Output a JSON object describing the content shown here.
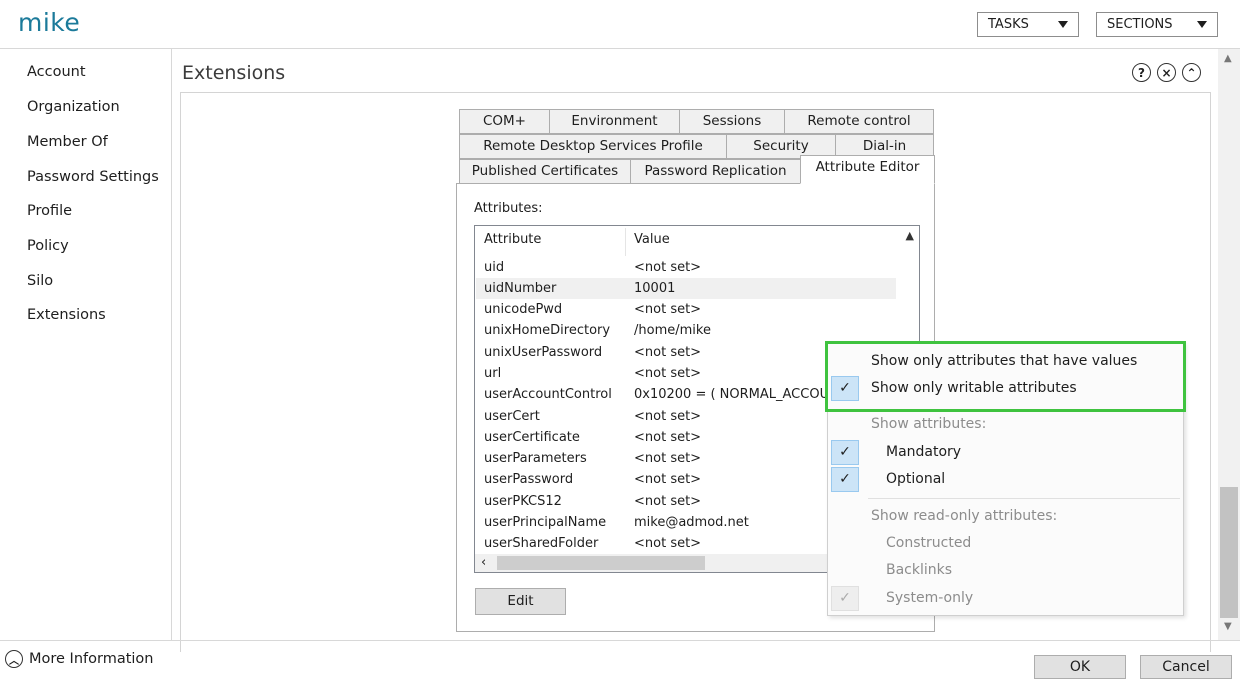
{
  "header": {
    "title": "mike",
    "tasks_label": "TASKS",
    "sections_label": "SECTIONS"
  },
  "nav": {
    "items": [
      {
        "label": "Account"
      },
      {
        "label": "Organization"
      },
      {
        "label": "Member Of"
      },
      {
        "label": "Password Settings"
      },
      {
        "label": "Profile"
      },
      {
        "label": "Policy"
      },
      {
        "label": "Silo"
      },
      {
        "label": "Extensions"
      }
    ]
  },
  "section": {
    "title": "Extensions",
    "help_icon": "?",
    "close_icon": "×",
    "collapse_icon": "⌃"
  },
  "dialog": {
    "tabs_row1": [
      {
        "label": "COM+"
      },
      {
        "label": "Environment"
      },
      {
        "label": "Sessions"
      },
      {
        "label": "Remote control"
      }
    ],
    "tabs_row2": [
      {
        "label": "Remote Desktop Services Profile"
      },
      {
        "label": "Security"
      },
      {
        "label": "Dial-in"
      }
    ],
    "tabs_row3": [
      {
        "label": "Published Certificates"
      },
      {
        "label": "Password Replication"
      },
      {
        "label": "Attribute Editor"
      }
    ],
    "attributes_label": "Attributes:",
    "columns": {
      "attribute": "Attribute",
      "value": "Value"
    },
    "rows": [
      {
        "attribute": "uid",
        "value": "<not set>"
      },
      {
        "attribute": "uidNumber",
        "value": "10001"
      },
      {
        "attribute": "unicodePwd",
        "value": "<not set>"
      },
      {
        "attribute": "unixHomeDirectory",
        "value": "/home/mike"
      },
      {
        "attribute": "unixUserPassword",
        "value": "<not set>"
      },
      {
        "attribute": "url",
        "value": "<not set>"
      },
      {
        "attribute": "userAccountControl",
        "value": "0x10200 = ( NORMAL_ACCOUNT"
      },
      {
        "attribute": "userCert",
        "value": "<not set>"
      },
      {
        "attribute": "userCertificate",
        "value": "<not set>"
      },
      {
        "attribute": "userParameters",
        "value": "<not set>"
      },
      {
        "attribute": "userPassword",
        "value": "<not set>"
      },
      {
        "attribute": "userPKCS12",
        "value": "<not set>"
      },
      {
        "attribute": "userPrincipalName",
        "value": "mike@admod.net"
      },
      {
        "attribute": "userSharedFolder",
        "value": "<not set>"
      }
    ],
    "selected_row": "uidNumber",
    "edit_label": "Edit"
  },
  "menu": {
    "items": [
      {
        "label": "Show only attributes that have values",
        "checked": false
      },
      {
        "label": "Show only writable attributes",
        "checked": true
      }
    ],
    "show_attributes_header": "Show attributes:",
    "show_attributes": [
      {
        "label": "Mandatory",
        "checked": true
      },
      {
        "label": "Optional",
        "checked": true
      }
    ],
    "readonly_header": "Show read-only attributes:",
    "readonly": [
      {
        "label": "Constructed",
        "checked": false
      },
      {
        "label": "Backlinks",
        "checked": false
      },
      {
        "label": "System-only",
        "checked": true
      }
    ],
    "check_glyph": "✓",
    "highlight_color": "#3fc33f"
  },
  "footer": {
    "more_info_label": "More Information",
    "ok_label": "OK",
    "cancel_label": "Cancel"
  }
}
